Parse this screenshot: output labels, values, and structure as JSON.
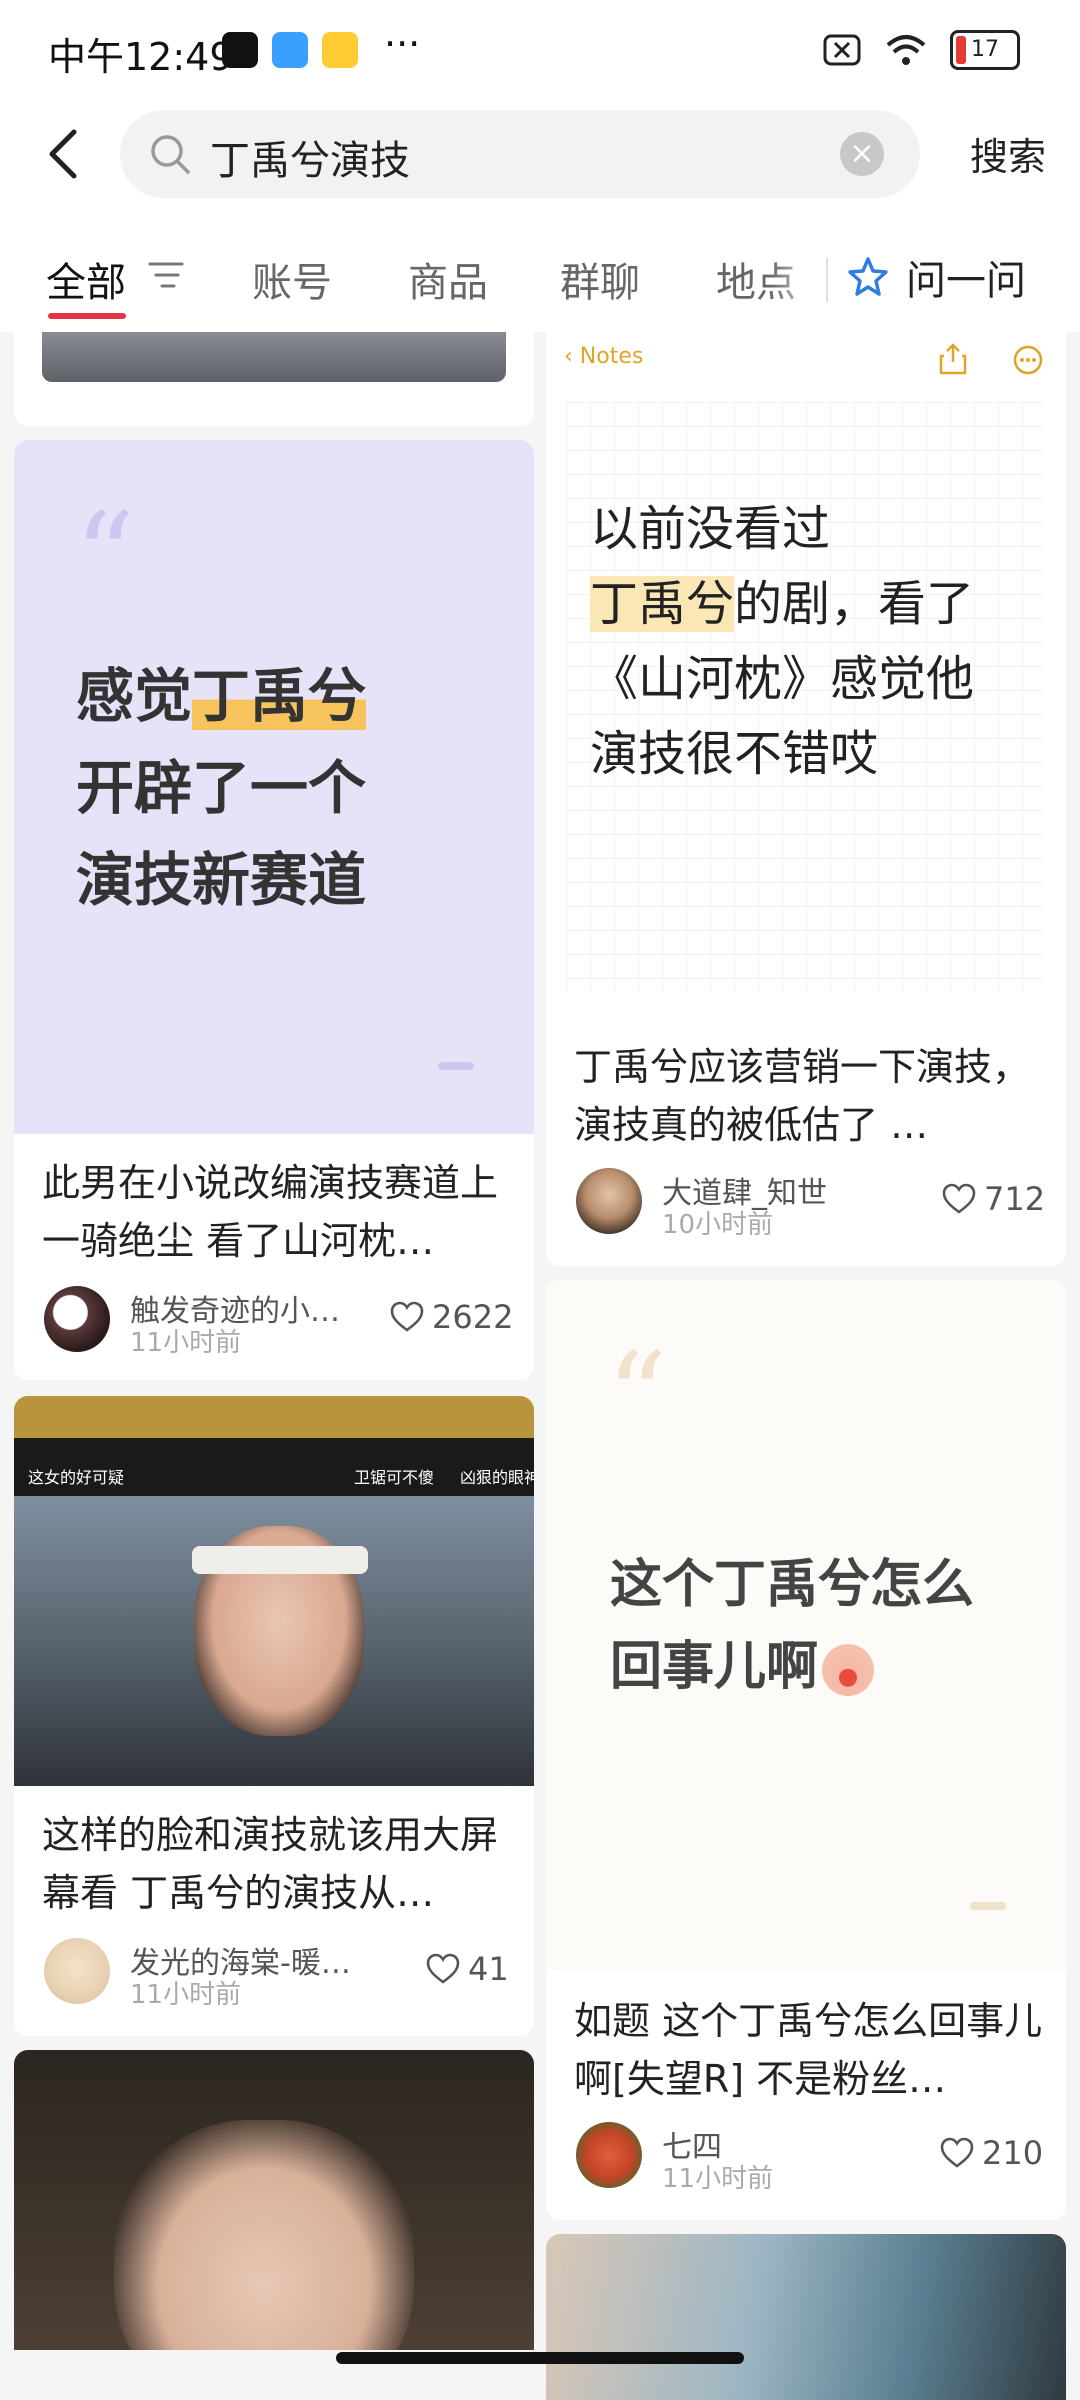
{
  "status": {
    "time": "中午12:49",
    "more": "···",
    "battery": "17"
  },
  "search": {
    "value": "丁禹兮演技",
    "button": "搜索"
  },
  "tabs": [
    {
      "label": "全部"
    },
    {
      "label": "账号"
    },
    {
      "label": "商品"
    },
    {
      "label": "群聊"
    },
    {
      "label": "地点"
    }
  ],
  "ask_label": "问一问",
  "colors": {
    "accent": "#e8334a",
    "highlight": "#f7c35c",
    "lilac": "#e6e2f7"
  },
  "left_col": [
    {
      "image_quote": [
        "感觉",
        "丁禹兮",
        "开辟了一个",
        "演技新赛道"
      ],
      "title": "此男在小说改编演技赛道上一骑绝尘 看了山河枕…",
      "author": "触发奇迹的小…",
      "time": "11小时前",
      "likes": "2622"
    },
    {
      "image_caption_left": "这女的好可疑",
      "image_caption_mid": "卫锯可不傻",
      "image_caption_right": "凶狠的眼神 演",
      "title": "这样的脸和演技就该用大屏幕看 丁禹兮的演技从…",
      "author": "发光的海棠-暖…",
      "time": "11小时前",
      "likes": "41"
    }
  ],
  "right_col": [
    {
      "notes_back": "Notes",
      "note_lines": [
        "以前没看过",
        "丁禹兮",
        "的剧，看了",
        "《山河枕》感觉他",
        "演技很不错哎"
      ],
      "title": "丁禹兮应该营销一下演技，演技真的被低估了 …",
      "author": "大道肆_知世",
      "time": "10小时前",
      "likes": "712"
    },
    {
      "quote_lines": [
        "这个丁禹兮怎么",
        "回事儿啊"
      ],
      "title": "如题 这个丁禹兮怎么回事儿啊[失望R] 不是粉丝…",
      "author": "七四",
      "time": "11小时前",
      "likes": "210"
    }
  ]
}
